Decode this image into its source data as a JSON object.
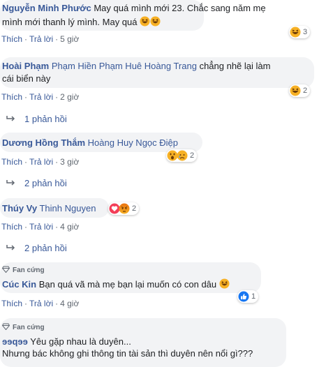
{
  "actions": {
    "like": "Thích",
    "dot": "·",
    "reply": "Trả lời"
  },
  "colors": {
    "link": "#385898",
    "bubble": "#f2f3f5",
    "meta": "#606770"
  },
  "comments": [
    {
      "author": "Nguyễn Minh Phước",
      "line1": "May quá mình mới 23. Chắc sang năm mẹ",
      "line2": "mình mới thanh lý mình. May quá",
      "time": "5 giờ",
      "reaction_count": "3",
      "reaction_icon": "haha-icon"
    },
    {
      "author": "Hoài Phạm",
      "tags": "Phạm Hiền Phạm Huê Hoàng Trang",
      "text_tail": "chẳng nhẽ lại làm",
      "line2": "cái biển này",
      "time": "2 giờ",
      "reaction_count": "2",
      "reaction_icon": "haha-icon",
      "replies": "1 phản hồi"
    },
    {
      "author": "Dương Hồng Thắm",
      "tags": "Hoàng Huy Ngọc Điệp",
      "time": "3 giờ",
      "reaction_count": "2",
      "reaction_icons": [
        "wow-icon",
        "sad-icon"
      ],
      "replies": "2 phản hồi"
    },
    {
      "author": "Thúy Vy",
      "tags": "Thinh Nguyen",
      "time": "4 giờ",
      "reaction_count": "2",
      "reaction_icons": [
        "love-icon",
        "angry-icon"
      ],
      "replies": "2 phản hồi"
    },
    {
      "badge": "Fan cứng",
      "author": "Cúc Kin",
      "text": "Bạn quá vã mà mẹ bạn lại muốn có con dâu",
      "time": "4 giờ",
      "reaction_count": "1",
      "reaction_icon": "like-icon"
    },
    {
      "badge": "Fan cứng",
      "author": "ɘɘqɘɘ",
      "line1": "Yêu gặp nhau là duyên...",
      "line2": "Nhưng bác không ghi thông tin tài sản thì duyên nên nổi gì???"
    }
  ]
}
